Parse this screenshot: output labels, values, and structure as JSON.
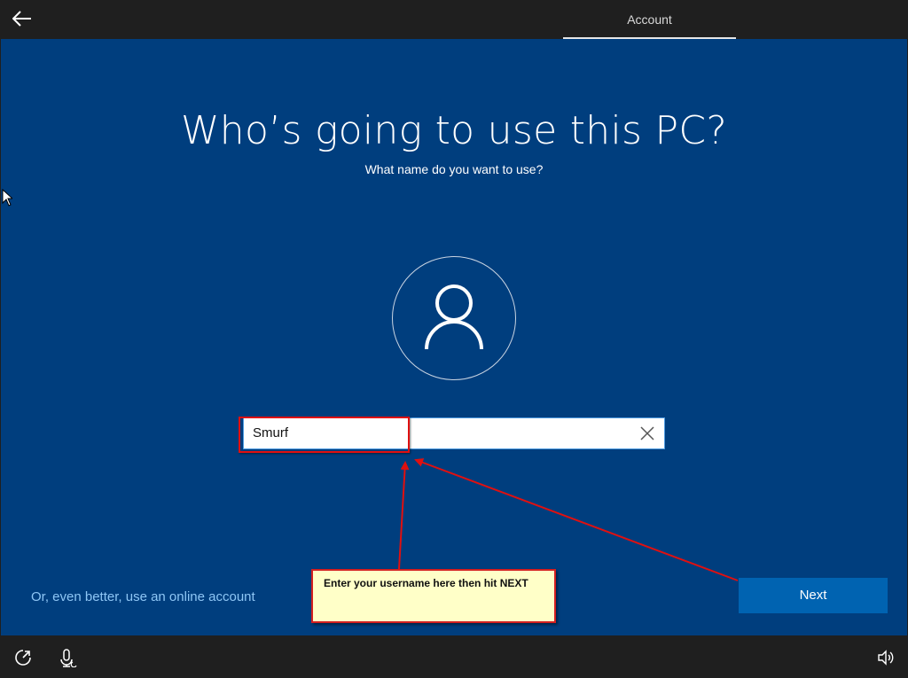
{
  "header": {
    "tab_label": "Account",
    "back_icon": "arrow-left-icon"
  },
  "main": {
    "title": "Who’s going to use this PC?",
    "subtitle": "What name do you want to use?",
    "avatar_icon": "user-icon",
    "name_input": {
      "value": "Smurf",
      "clear_icon": "close-icon"
    },
    "online_account_link": "Or, even better, use an online account",
    "next_label": "Next"
  },
  "annotation": {
    "callout_text": "Enter your username here then hit NEXT",
    "color": "#e01010"
  },
  "footer": {
    "icons": [
      "ease-of-access-icon",
      "microphone-icon",
      "volume-icon"
    ]
  },
  "colors": {
    "background": "#003e7e",
    "chrome": "#1f1f1f",
    "accent": "#0063b1",
    "link": "#8ec6f5"
  }
}
